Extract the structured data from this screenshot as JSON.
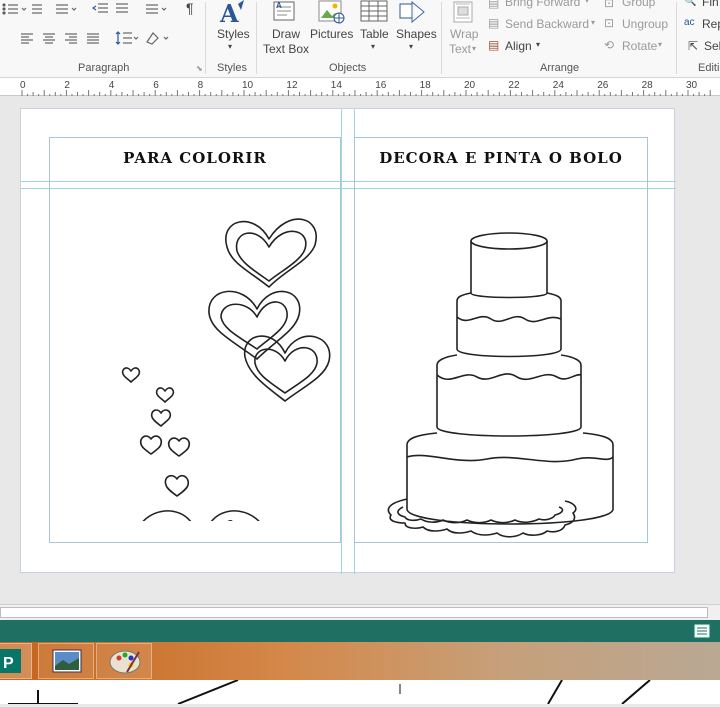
{
  "ribbon": {
    "paragraph_label": "Paragraph",
    "styles_group_label": "Styles",
    "objects_label": "Objects",
    "arrange_label": "Arrange",
    "editing_label": "Editi",
    "styles_button": "Styles",
    "draw_textbox_line1": "Draw",
    "draw_textbox_line2": "Text Box",
    "pictures": "Pictures",
    "table": "Table",
    "shapes": "Shapes",
    "wrap_line1": "Wrap",
    "wrap_line2": "Text",
    "bring_forward": "Bring Forward",
    "send_backward": "Send Backward",
    "align": "Align",
    "group": "Group",
    "ungroup": "Ungroup",
    "rotate": "Rotate",
    "find": "Fin",
    "replace": "Rep",
    "select": "Sel"
  },
  "ruler": {
    "ticks": [
      "0",
      "2",
      "4",
      "6",
      "8",
      "10",
      "12",
      "14",
      "16",
      "18",
      "20",
      "22",
      "24",
      "26",
      "28",
      "30"
    ]
  },
  "document": {
    "left_title": "PARA COLORIR",
    "right_title": "DECORA E PINTA O BOLO"
  },
  "colors": {
    "status_bar": "#1f6f62",
    "guide": "#9fd3e6"
  }
}
